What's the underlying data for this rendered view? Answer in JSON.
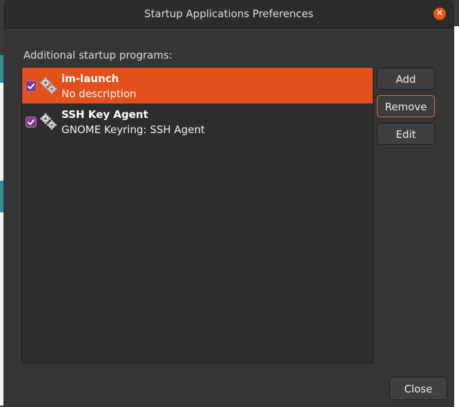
{
  "window": {
    "title": "Startup Applications Preferences",
    "close_glyph": "✕"
  },
  "section_label": "Additional startup programs:",
  "programs": [
    {
      "name": "im-launch",
      "description": "No description",
      "enabled": true,
      "selected": true,
      "icon": "gears-icon"
    },
    {
      "name": "SSH Key Agent",
      "description": "GNOME Keyring: SSH Agent",
      "enabled": true,
      "selected": false,
      "icon": "gears-icon"
    }
  ],
  "buttons": {
    "add": "Add",
    "remove": "Remove",
    "edit": "Edit",
    "close": "Close"
  },
  "colors": {
    "accent": "#e2511d",
    "checkbox": "#7e3f86",
    "window_bg": "#353535",
    "list_bg": "#2d2d2d"
  }
}
